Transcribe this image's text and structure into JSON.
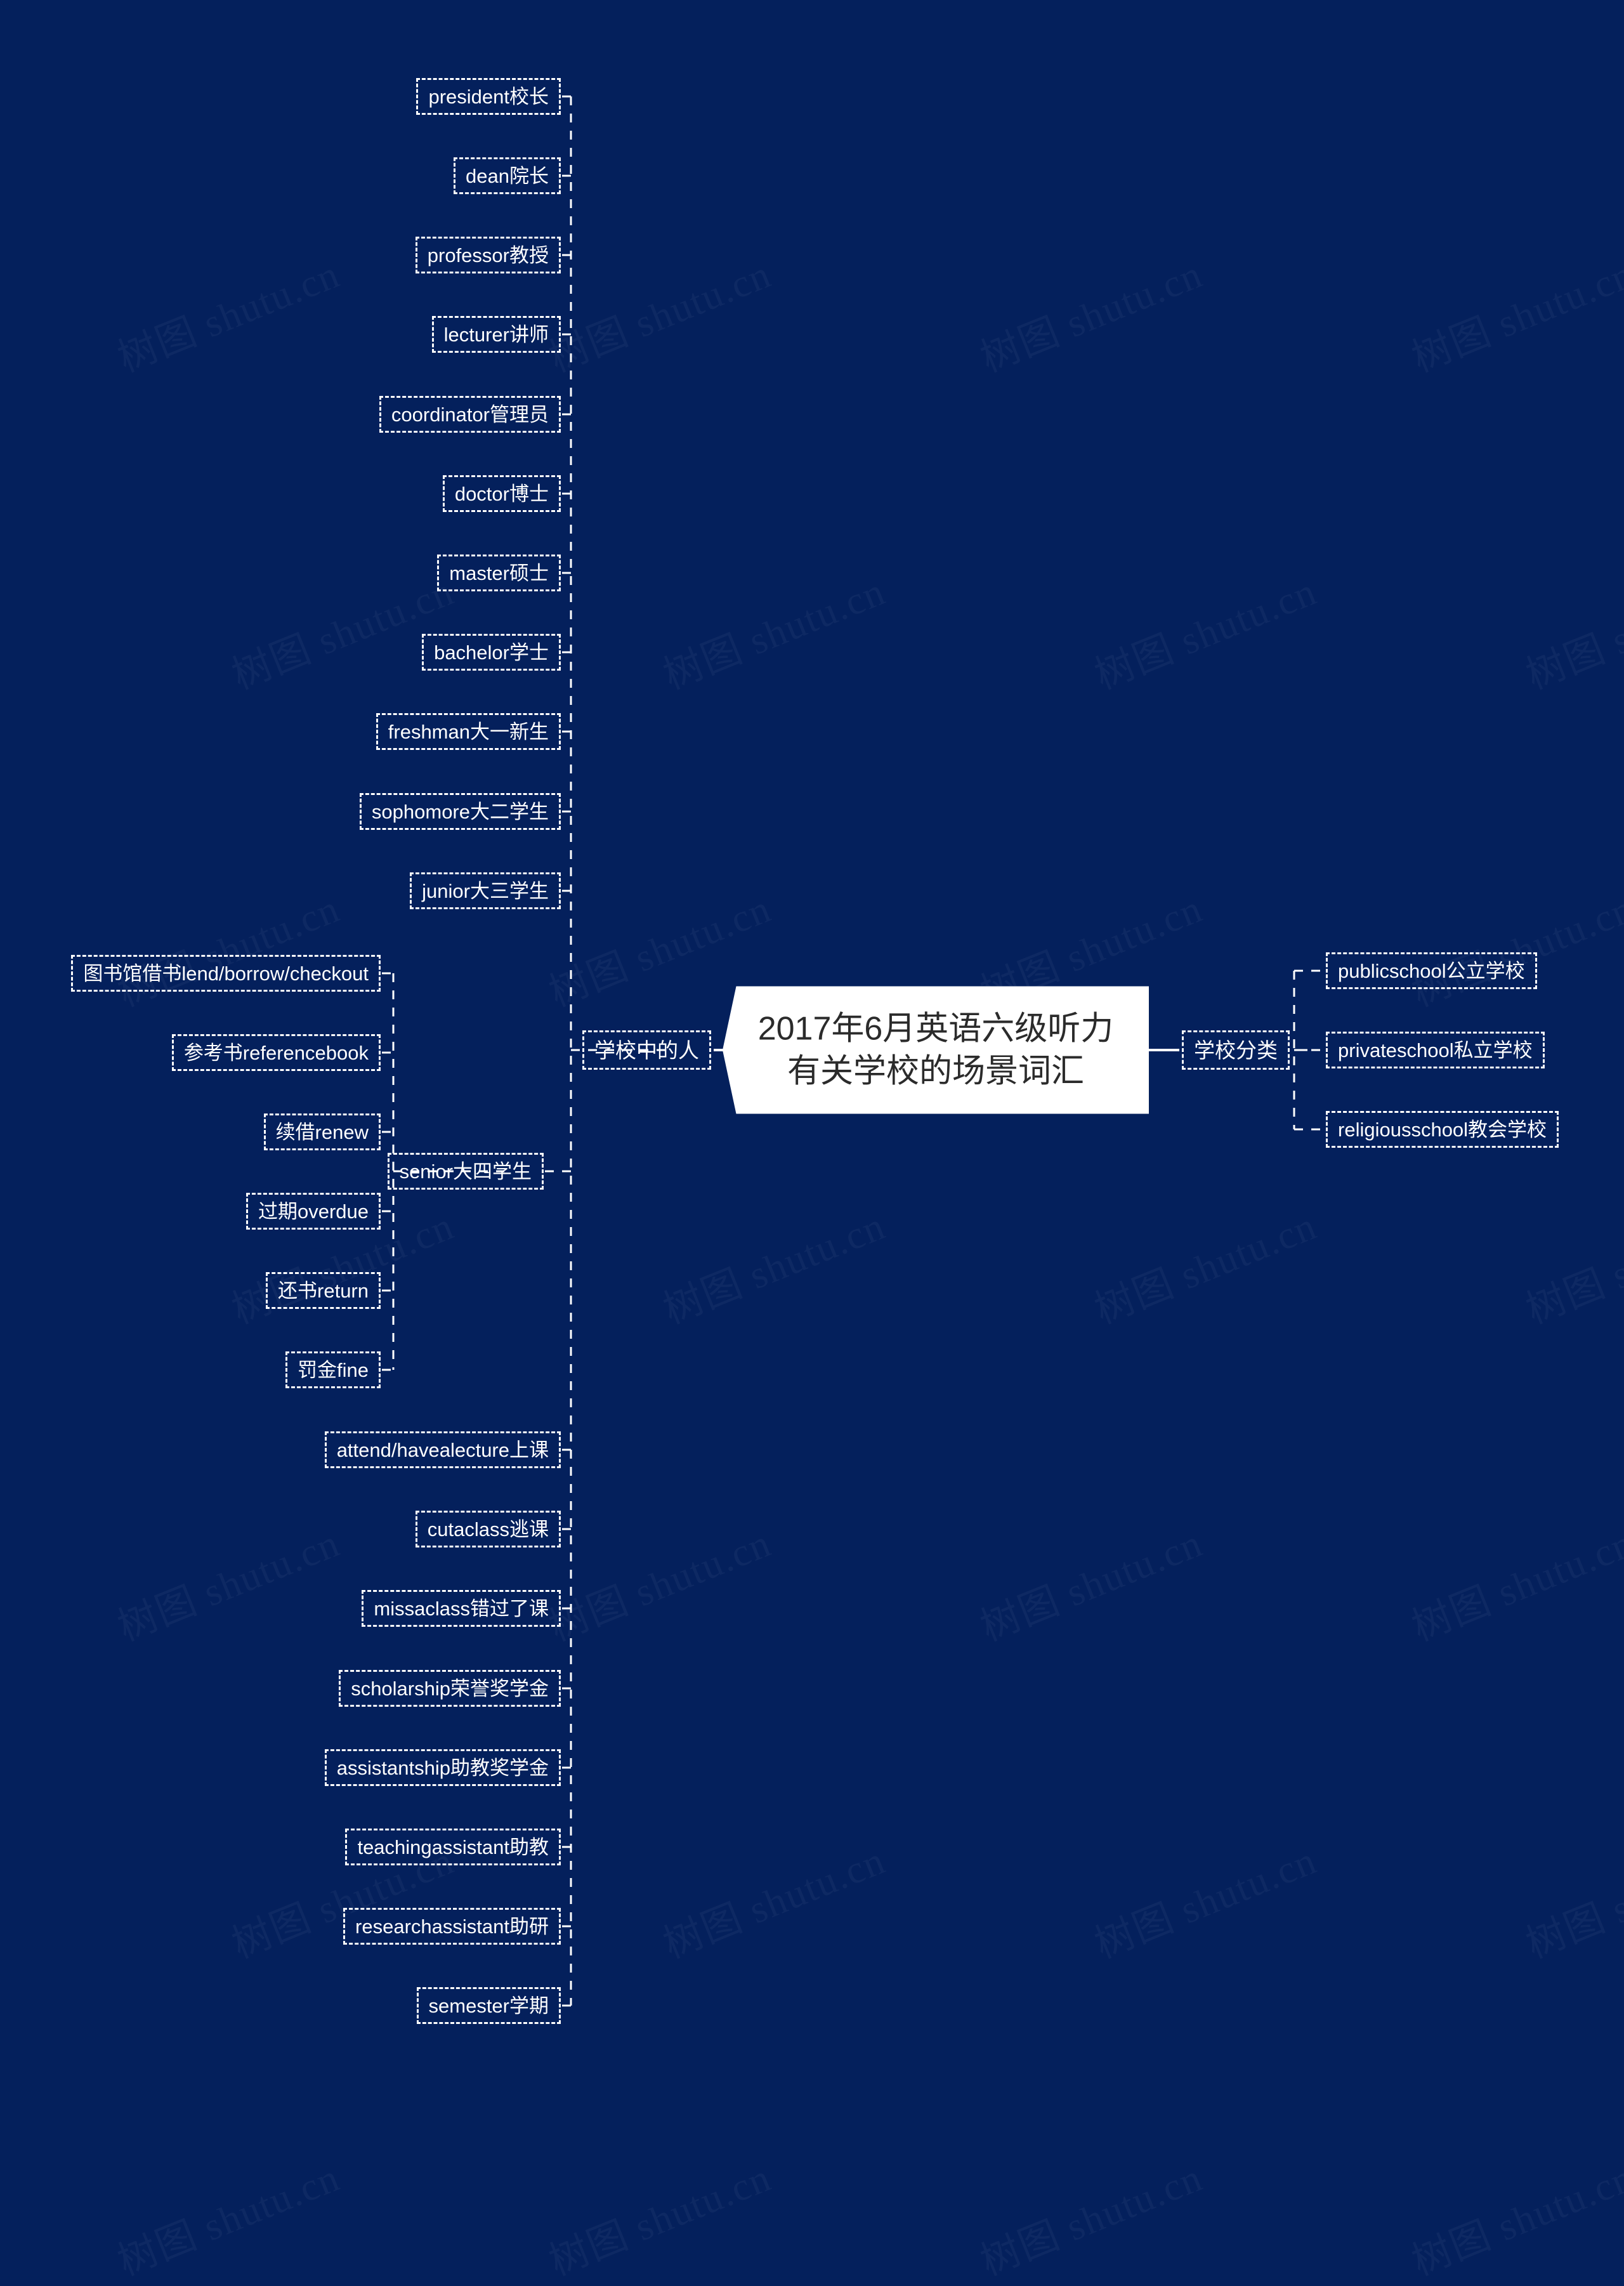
{
  "background_color": "#04205c",
  "node_border_color": "#ffffff",
  "root": {
    "title": "2017年6月英语六级听力\n有关学校的场景词汇",
    "text_color": "#2b2b2b",
    "fill_color": "#ffffff"
  },
  "watermark": {
    "text": "树图 shutu.cn"
  },
  "branches": [
    {
      "id": "people-in-school",
      "label": "学校中的人",
      "side": "left",
      "children": [
        {
          "label": "president校长"
        },
        {
          "label": "dean院长"
        },
        {
          "label": "professor教授"
        },
        {
          "label": "lecturer讲师"
        },
        {
          "label": "coordinator管理员"
        },
        {
          "label": "doctor博士"
        },
        {
          "label": "master硕士"
        },
        {
          "label": "bachelor学士"
        },
        {
          "label": "freshman大一新生"
        },
        {
          "label": "sophomore大二学生"
        },
        {
          "label": "junior大三学生"
        },
        {
          "label": "senior大四学生",
          "children": [
            {
              "label": "图书馆借书lend/borrow/checkout"
            },
            {
              "label": "参考书referencebook"
            },
            {
              "label": "续借renew"
            },
            {
              "label": "过期overdue"
            },
            {
              "label": "还书return"
            },
            {
              "label": "罚金fine"
            }
          ]
        },
        {
          "label": "attend/havealecture上课"
        },
        {
          "label": "cutaclass逃课"
        },
        {
          "label": "missaclass错过了课"
        },
        {
          "label": "scholarship荣誉奖学金"
        },
        {
          "label": "assistantship助教奖学金"
        },
        {
          "label": "teachingassistant助教"
        },
        {
          "label": "researchassistant助研"
        },
        {
          "label": "semester学期"
        }
      ]
    },
    {
      "id": "school-types",
      "label": "学校分类",
      "side": "right",
      "children": [
        {
          "label": "publicschool公立学校"
        },
        {
          "label": "privateschool私立学校"
        },
        {
          "label": "religiousschool教会学校"
        }
      ]
    }
  ]
}
